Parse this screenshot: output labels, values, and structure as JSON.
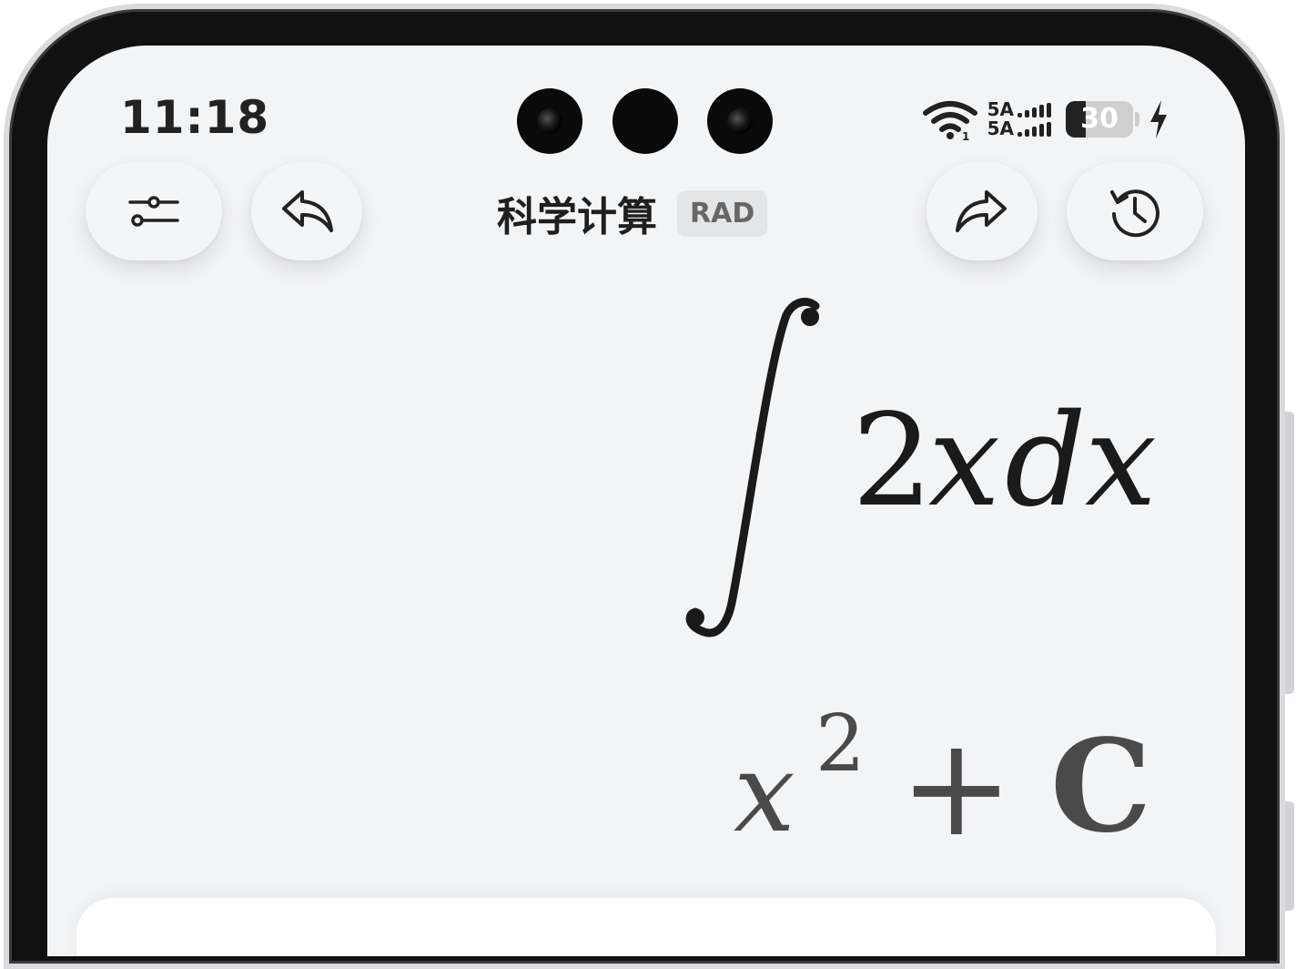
{
  "status_bar": {
    "time": "11:18",
    "network_top": "5A",
    "network_bottom": "5A",
    "battery_percent": "30",
    "battery_level": 0.3
  },
  "toolbar": {
    "title": "科学计算",
    "angle_mode": "RAD",
    "left_buttons": [
      "settings-sliders-icon",
      "undo-icon"
    ],
    "right_buttons": [
      "redo-icon",
      "history-icon"
    ]
  },
  "display": {
    "expression": {
      "integral_symbol": "∫",
      "integrand_coefficient": "2",
      "integrand_variable": "x",
      "differential_d": "d",
      "differential_variable": "x"
    },
    "result": {
      "variable": "x",
      "exponent": "2",
      "operator": "+",
      "constant": "C"
    }
  },
  "colors": {
    "screen_background": "#f3f4f6",
    "expression_text": "#1a1a1a",
    "result_text": "#4a4a4a",
    "badge_background": "#e4e5e7"
  }
}
